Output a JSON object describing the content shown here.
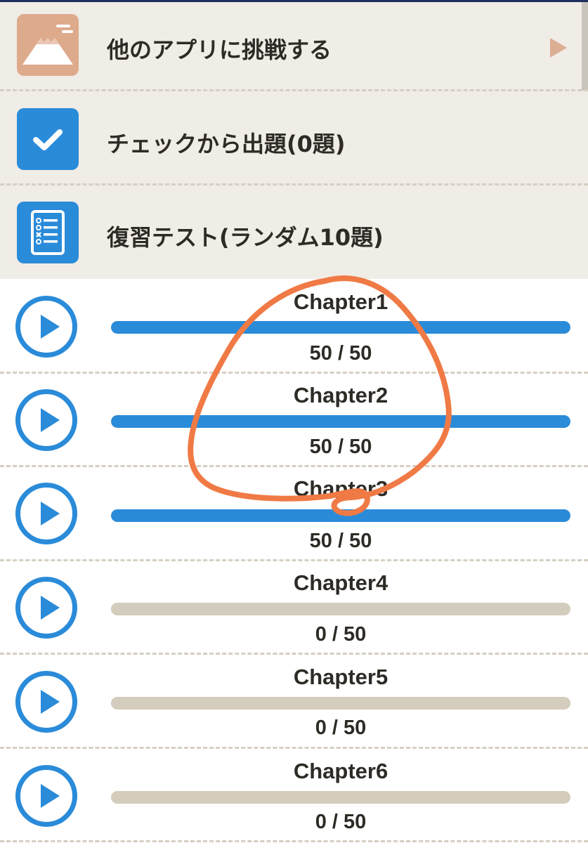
{
  "colors": {
    "accent": "#2a8bd9",
    "track": "#d4ccbc",
    "menu_bg": "#f0ece6",
    "app_icon_bg": "#deaa8c",
    "annotation": "#f07a45"
  },
  "menu": {
    "items": [
      {
        "label": "他のアプリに挑戦する",
        "icon": "mountain-icon"
      },
      {
        "label": "チェックから出題(0題)",
        "icon": "checkmark-icon"
      },
      {
        "label": "復習テスト(ランダム10題)",
        "icon": "checklist-icon"
      }
    ]
  },
  "chapters": [
    {
      "title": "Chapter1",
      "score": "50 / 50",
      "progress": 1.0
    },
    {
      "title": "Chapter2",
      "score": "50 / 50",
      "progress": 1.0
    },
    {
      "title": "Chapter3",
      "score": "50 / 50",
      "progress": 1.0
    },
    {
      "title": "Chapter4",
      "score": "0 / 50",
      "progress": 0.0
    },
    {
      "title": "Chapter5",
      "score": "0 / 50",
      "progress": 0.0
    },
    {
      "title": "Chapter6",
      "score": "0 / 50",
      "progress": 0.0
    }
  ]
}
